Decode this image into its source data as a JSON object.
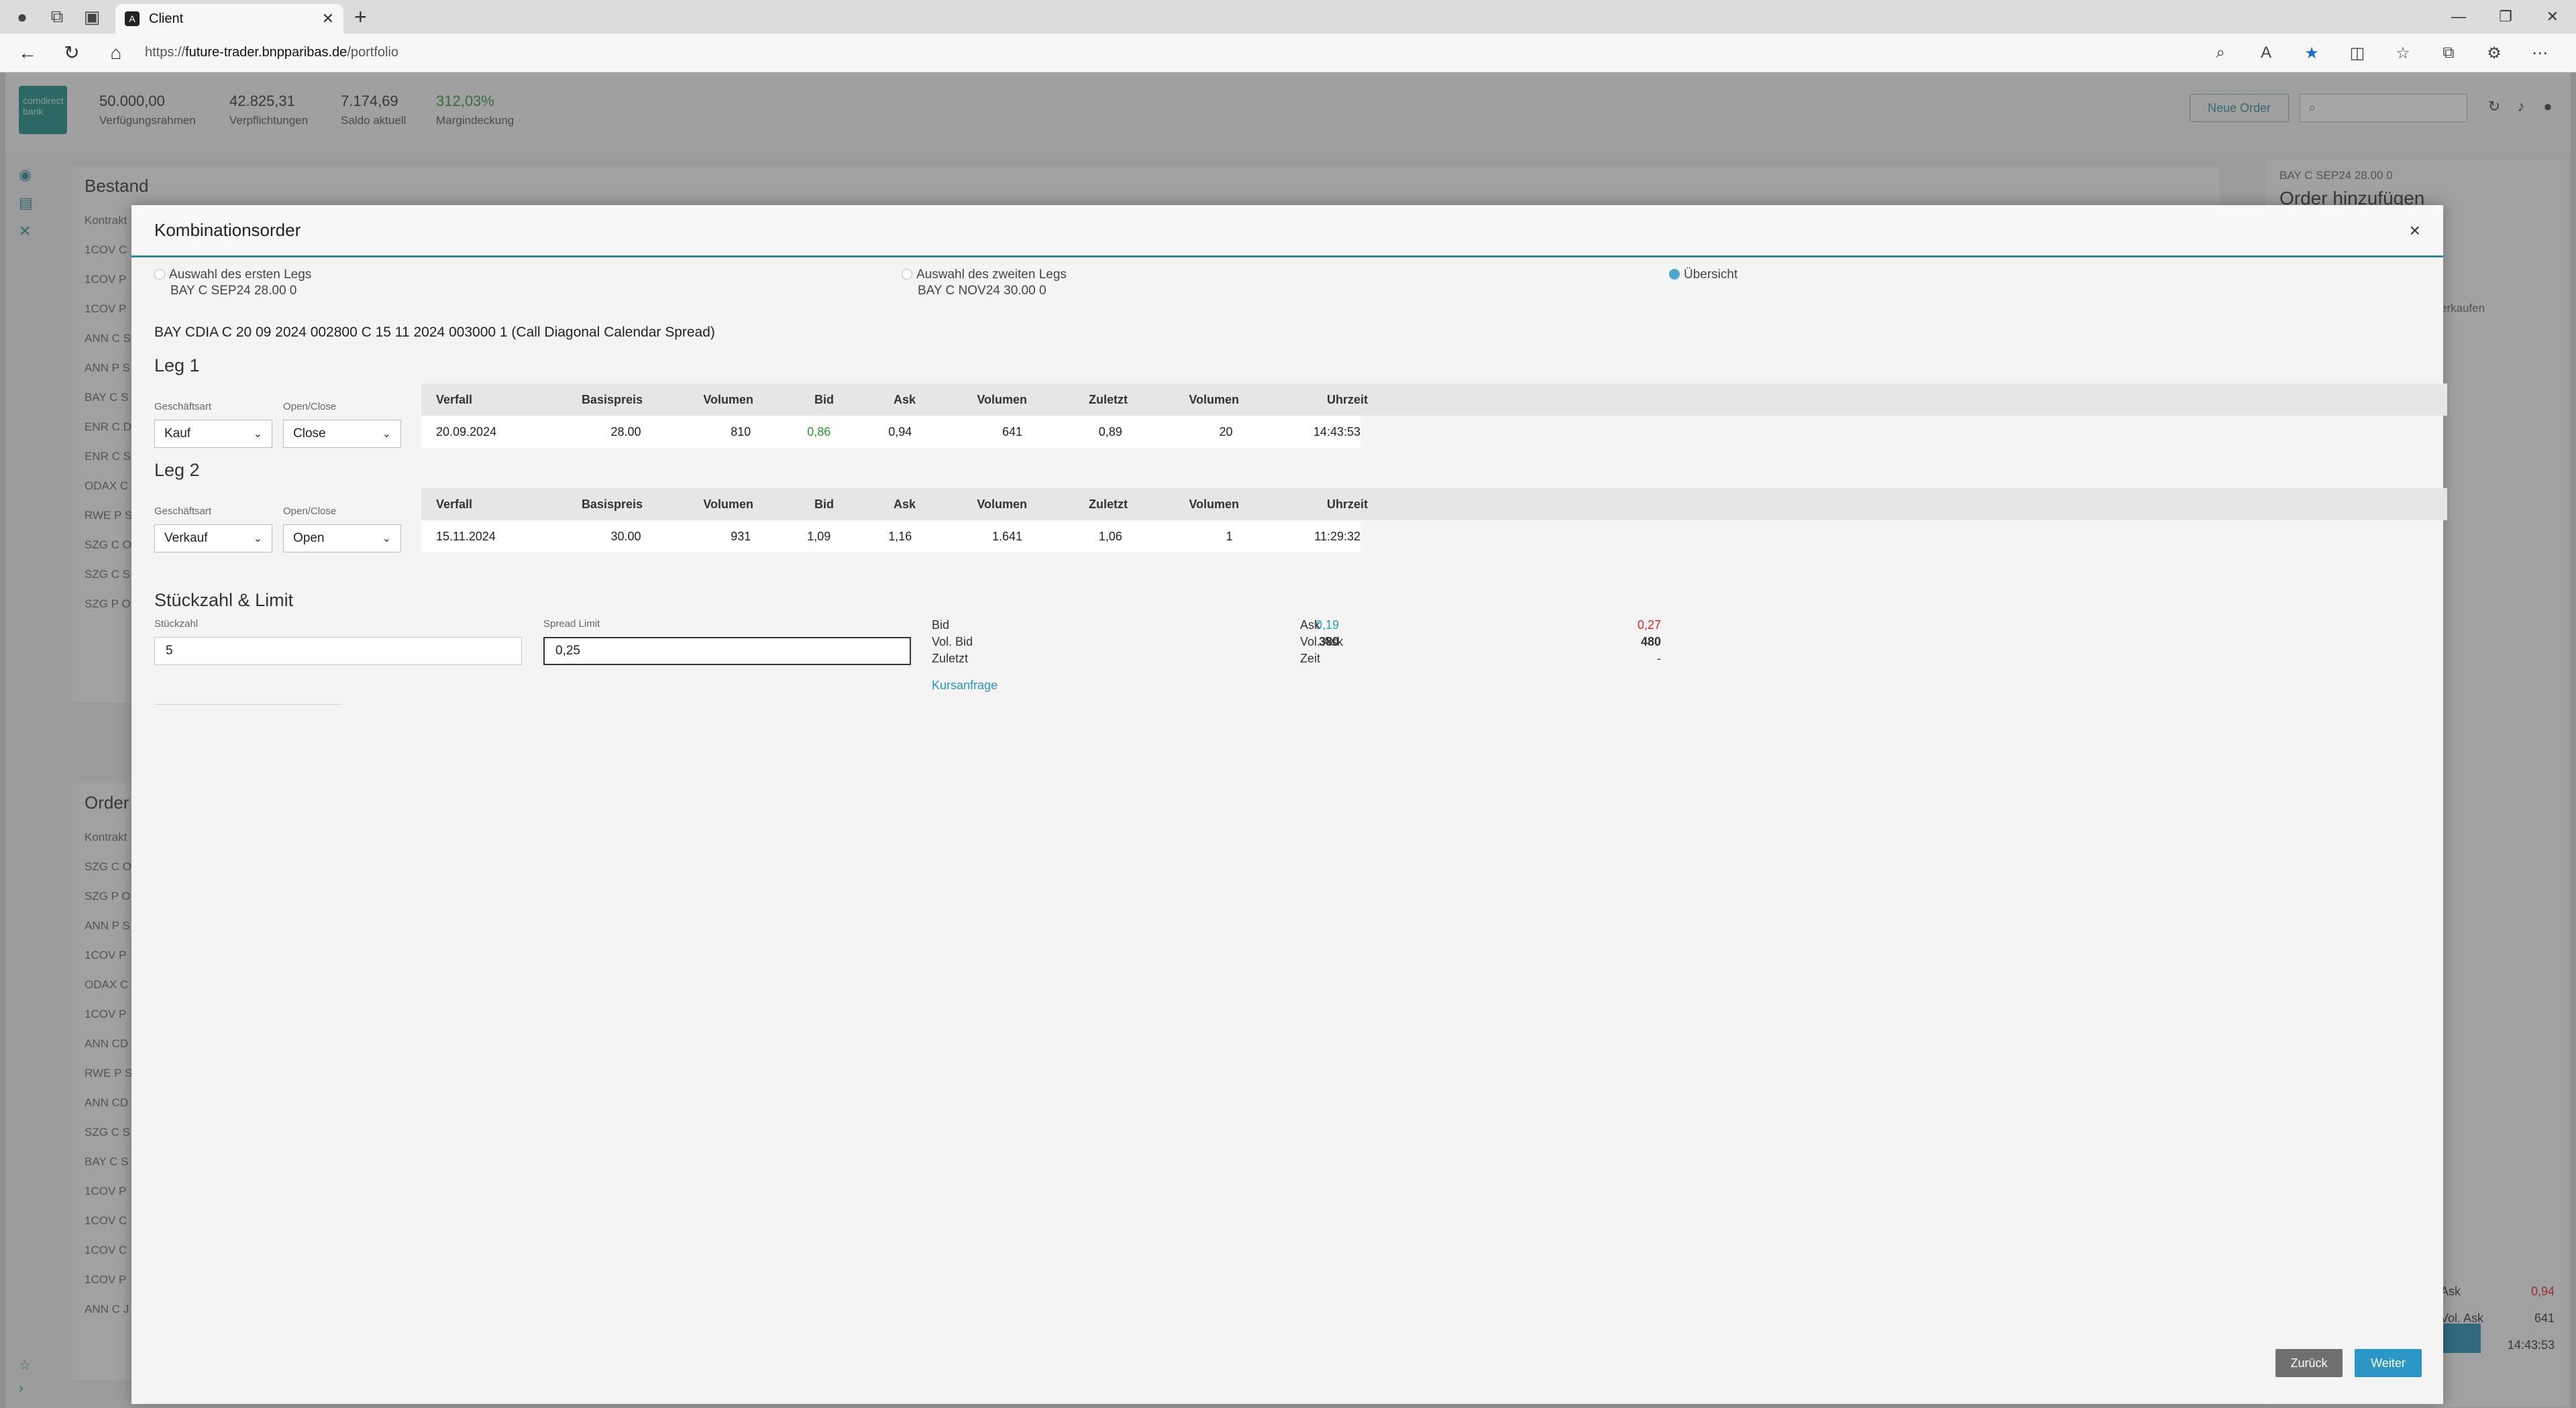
{
  "browser": {
    "tab_title": "Client",
    "url_scheme": "https://",
    "url_host": "future-trader.bnpparibas.de",
    "url_path": "/portfolio"
  },
  "header": {
    "logo_text": "comdirect bank",
    "kpis": [
      {
        "value": "50.000,00",
        "label": "Verfügungsrahmen"
      },
      {
        "value": "42.825,31",
        "label": "Verpflichtungen"
      },
      {
        "value": "7.174,69",
        "label": "Saldo aktuell"
      },
      {
        "value": "312,03%",
        "label": "Margindeckung"
      }
    ],
    "new_order_label": "Neue Order"
  },
  "background": {
    "bestand_title": "Bestand",
    "bestand_col": "Kontrakt",
    "bestand_rows": [
      "1COV C",
      "1COV P",
      "1COV P",
      "ANN C S",
      "ANN P S",
      "BAY C S",
      "ENR C D",
      "ENR C S",
      "ODAX C",
      "RWE P S",
      "SZG C O",
      "SZG C S",
      "SZG P O"
    ],
    "order_title": "Order",
    "order_col": "Kontrakt",
    "order_rows": [
      "SZG C O",
      "SZG P O",
      "ANN P S",
      "1COV P",
      "ODAX C",
      "1COV P",
      "ANN CD",
      "RWE P S",
      "ANN CD",
      "SZG C S",
      "BAY C S",
      "1COV P",
      "1COV C",
      "1COV C",
      "1COV P",
      "ANN C J"
    ],
    "right_sub": "BAY C SEP24 28.00 0",
    "right_title": "Order hinzufügen",
    "right_btn": "Weiter",
    "right_frag": "erkaufen",
    "right_quote": [
      {
        "label": "Ask",
        "value": "0,94"
      },
      {
        "label": "Vol. Ask",
        "value": "641"
      },
      {
        "label": "Zeit",
        "value": "14:43:53"
      }
    ]
  },
  "modal": {
    "title": "Kombinationsorder",
    "steps": [
      {
        "label": "Auswahl des ersten Legs",
        "sub": "BAY C SEP24 28.00 0"
      },
      {
        "label": "Auswahl des zweiten Legs",
        "sub": "BAY C NOV24 30.00 0"
      },
      {
        "label": "Übersicht",
        "sub": ""
      }
    ],
    "combo_name": "BAY CDIA C 20 09 2024 002800 C 15 11 2024 003000 1 (Call Diagonal Calendar Spread)",
    "columns": [
      "Verfall",
      "Basispreis",
      "Volumen",
      "Bid",
      "Ask",
      "Volumen",
      "Zuletzt",
      "Volumen",
      "Uhrzeit"
    ],
    "geschaeftsart_label": "Geschäftsart",
    "openclose_label": "Open/Close",
    "leg1": {
      "title": "Leg 1",
      "geschaeftsart": "Kauf",
      "openclose": "Close",
      "row": [
        "20.09.2024",
        "28.00",
        "810",
        "0,86",
        "0,94",
        "641",
        "0,89",
        "20",
        "14:43:53"
      ]
    },
    "leg2": {
      "title": "Leg 2",
      "geschaeftsart": "Verkauf",
      "openclose": "Open",
      "row": [
        "15.11.2024",
        "30.00",
        "931",
        "1,09",
        "1,16",
        "1.641",
        "1,06",
        "1",
        "11:29:32"
      ]
    },
    "stueck_section": "Stückzahl & Limit",
    "stueck_label": "Stückzahl",
    "stueck_value": "5",
    "spread_label": "Spread Limit",
    "spread_value": "0,25",
    "quote": {
      "bid_label": "Bid",
      "bid_value": "0,19",
      "volbid_label": "Vol. Bid",
      "volbid_value": "380",
      "zuletzt_label": "Zuletzt",
      "zuletzt_value": "",
      "ask_label": "Ask",
      "ask_value": "0,27",
      "volask_label": "Vol. Ask",
      "volask_value": "480",
      "zeit_label": "Zeit",
      "zeit_value": "-"
    },
    "kursanfrage": "Kursanfrage",
    "back_label": "Zurück",
    "next_label": "Weiter"
  }
}
